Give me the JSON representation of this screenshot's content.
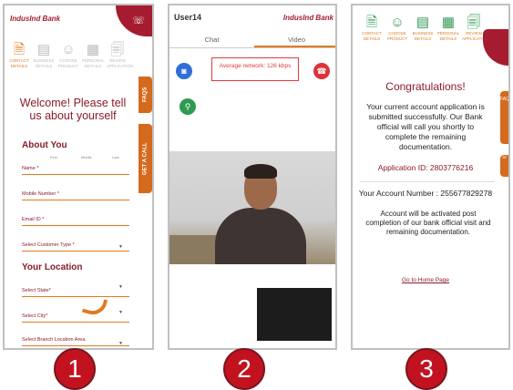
{
  "screens": [
    {
      "logo": "IndusInd Bank",
      "phone_icon": "phone-icon",
      "steps": [
        {
          "label": "CONTACT DETAILS",
          "icon": "document-icon",
          "active": true
        },
        {
          "label": "BUSINESS DETAILS",
          "icon": "id-card-icon",
          "active": false
        },
        {
          "label": "CHOOSE PRODUCT",
          "icon": "user-icon",
          "active": false
        },
        {
          "label": "PERSONAL DETAILS",
          "icon": "list-icon",
          "active": false
        },
        {
          "label": "REVIEW APPLICATION",
          "icon": "review-icon",
          "active": false
        }
      ],
      "welcome": "Welcome! Please tell us about yourself",
      "faqs_tab": "FAQS",
      "get_a_call_tab": "GET A CALL",
      "section_about": "About You",
      "name_label": "Name *",
      "name_sublabels": [
        "First",
        "Middle",
        "Last"
      ],
      "mobile_label": "Mobile Number *",
      "email_label": "Email ID *",
      "customer_type_label": "Select Customer Type *",
      "section_location": "Your Location",
      "state_label": "Select State*",
      "city_label": "Select City*",
      "branch_label": "Select Branch Location Area"
    },
    {
      "user": "User14",
      "logo": "IndusInd Bank",
      "tabs": [
        "Chat",
        "Video"
      ],
      "active_tab": "Video",
      "network_text": "Average network: 126 kbps",
      "camera_icon": "camera-icon",
      "hangup_icon": "hang-up-icon",
      "location_icon": "location-pin-icon"
    },
    {
      "steps": [
        "CONTACT DETAILS",
        "CHOOSE PRODUCT",
        "BUSINESS DETAILS",
        "PERSONAL DETAILS",
        "REVIEW APPLICATION"
      ],
      "congrats": "Congratulations!",
      "message": "Your current account application is submitted successfully. Our Bank official will call you shortly to complete the remaining documentation.",
      "application_id": "Application ID: 2803776216",
      "account_number": "Your Account Number : 255677829278",
      "activation_note": "Account will be activated post completion of our bank official visit and remaining documentation.",
      "home_link": "Go to Home Page",
      "faqs_tab": "FAQS"
    }
  ],
  "step_numbers": [
    "1",
    "2",
    "3"
  ],
  "colors": {
    "brand": "#a51c30",
    "accent": "#e07a20",
    "success": "#2e9a52"
  }
}
